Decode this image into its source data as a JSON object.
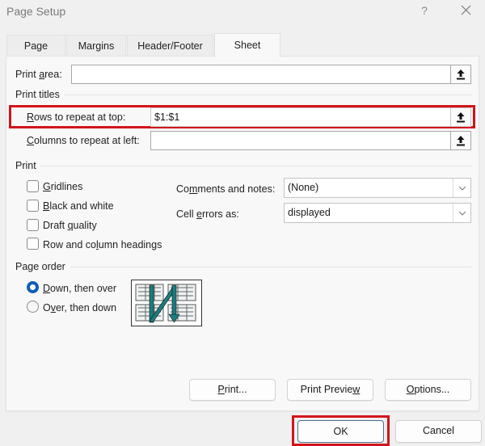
{
  "window": {
    "title": "Page Setup",
    "help_label": "?",
    "close_icon": "close-icon"
  },
  "tabs": [
    {
      "label": "Page",
      "active": false
    },
    {
      "label": "Margins",
      "active": false
    },
    {
      "label": "Header/Footer",
      "active": false
    },
    {
      "label": "Sheet",
      "active": true
    }
  ],
  "print_area": {
    "label_pre": "Print ",
    "label_u": "a",
    "label_post": "rea:",
    "value": "",
    "button_icon": "collapse-dialog-icon"
  },
  "print_titles": {
    "heading": "Print titles",
    "rows": {
      "label_u": "R",
      "label_post": "ows to repeat at top:",
      "value": "$1:$1",
      "highlighted": true
    },
    "columns": {
      "label_u": "C",
      "label_post": "olumns to repeat at left:",
      "value": ""
    }
  },
  "print": {
    "heading": "Print",
    "checkboxes": [
      {
        "label_pre": "",
        "label_u": "G",
        "label_post": "ridlines",
        "checked": false
      },
      {
        "label_pre": "",
        "label_u": "B",
        "label_post": "lack and white",
        "checked": false
      },
      {
        "label_pre": "Draft ",
        "label_u": "q",
        "label_post": "uality",
        "checked": false
      },
      {
        "label_pre": "Row and co",
        "label_u": "l",
        "label_post": "umn headings",
        "checked": false
      }
    ],
    "comments": {
      "label_pre": "Co",
      "label_u": "m",
      "label_post": "ments and notes:",
      "value": "(None)"
    },
    "cell_errors": {
      "label_pre": "Cell ",
      "label_u": "e",
      "label_post": "rrors as:",
      "value": "displayed"
    }
  },
  "page_order": {
    "heading": "Page order",
    "options": [
      {
        "label_pre": "",
        "label_u": "D",
        "label_post": "own, then over",
        "selected": true
      },
      {
        "label_pre": "O",
        "label_u": "v",
        "label_post": "er, then down",
        "selected": false
      }
    ],
    "preview_icon": "page-order-preview-icon"
  },
  "buttons": {
    "print": {
      "label_u": "P",
      "label_post": "rint..."
    },
    "print_preview": {
      "label_pre": "Print Previe",
      "label_u": "w"
    },
    "options": {
      "label_u": "O",
      "label_post": "ptions..."
    },
    "ok": "OK",
    "cancel": "Cancel"
  },
  "colors": {
    "highlight": "#d3141b",
    "radio_selected": "#0f5fb3",
    "arrow_teal": "#1a7d80"
  }
}
